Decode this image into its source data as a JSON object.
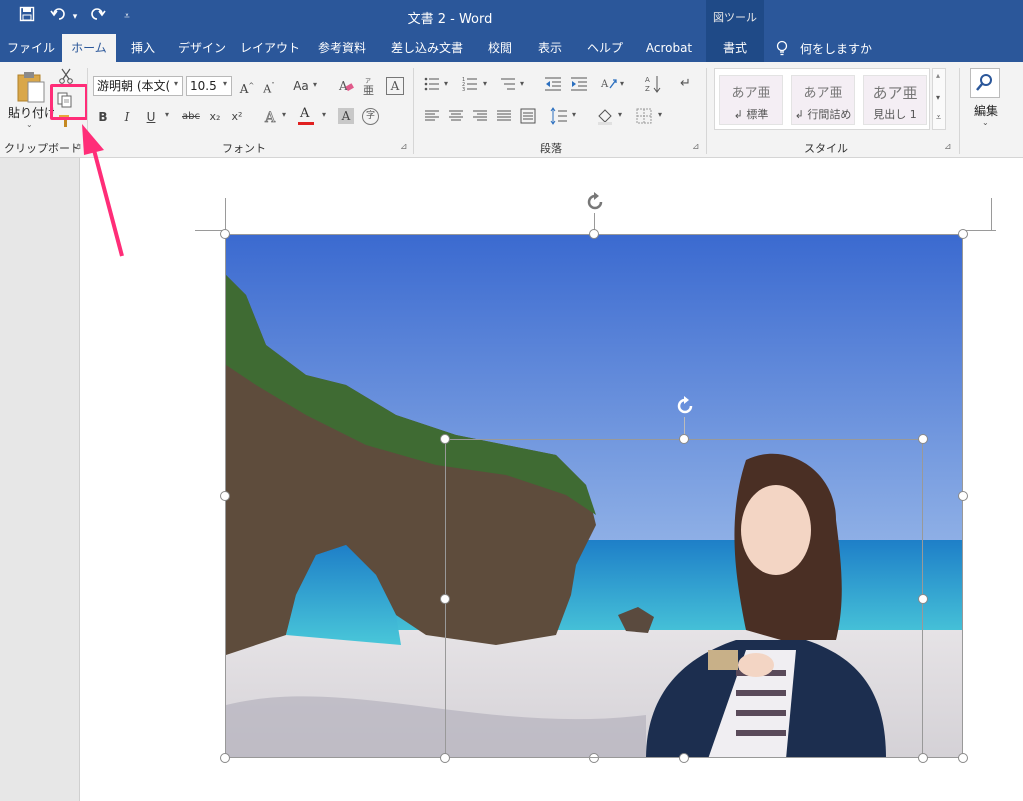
{
  "window": {
    "title": "文書 2  -  Word",
    "context_tool_label": "図ツール"
  },
  "tabs": [
    {
      "label": "ファイル",
      "active": false
    },
    {
      "label": "ホーム",
      "active": true
    },
    {
      "label": "挿入",
      "active": false
    },
    {
      "label": "デザイン",
      "active": false
    },
    {
      "label": "レイアウト",
      "active": false
    },
    {
      "label": "参考資料",
      "active": false
    },
    {
      "label": "差し込み文書",
      "active": false
    },
    {
      "label": "校閲",
      "active": false
    },
    {
      "label": "表示",
      "active": false
    },
    {
      "label": "ヘルプ",
      "active": false
    },
    {
      "label": "Acrobat",
      "active": false
    },
    {
      "label": "書式",
      "active": false
    }
  ],
  "tell_me": {
    "label": "何をしますか"
  },
  "clipboard": {
    "group_label": "クリップボード",
    "paste_label": "貼り付け"
  },
  "font": {
    "group_label": "フォント",
    "font_name": "游明朝 (本文(",
    "font_size": "10.5",
    "case_label": "Aa",
    "bold": "B",
    "italic": "I",
    "underline": "U",
    "strike": "abc",
    "subscript": "x₂",
    "superscript": "x²",
    "font_color_letter": "A"
  },
  "paragraph": {
    "group_label": "段落"
  },
  "styles": {
    "group_label": "スタイル",
    "items": [
      {
        "preview": "あア亜",
        "name": "↲ 標準"
      },
      {
        "preview": "あア亜",
        "name": "↲ 行間詰め"
      },
      {
        "preview": "あア亜",
        "name": "見出し 1"
      }
    ]
  },
  "editing": {
    "label": "編集"
  },
  "colors": {
    "ribbon_blue": "#2b579a",
    "annotation_pink": "#ff2d78",
    "font_red": "#e02020"
  }
}
